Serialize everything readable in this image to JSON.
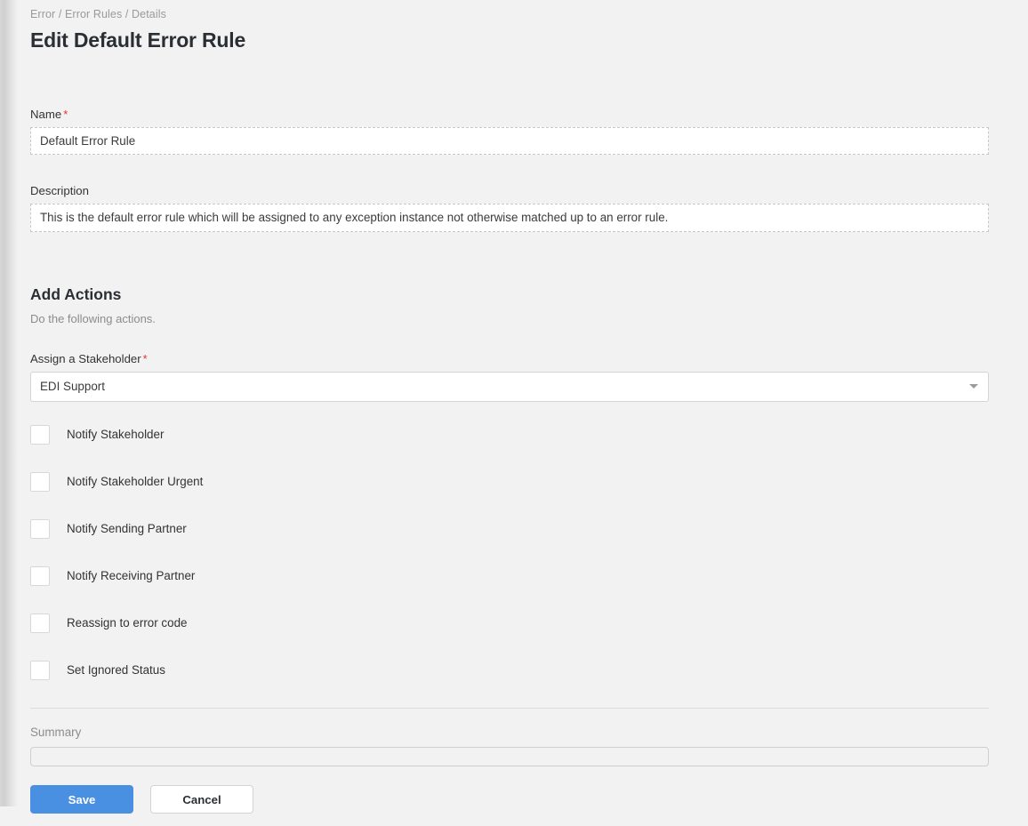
{
  "breadcrumb": {
    "text": "Error / Error Rules / Details"
  },
  "header": {
    "title": "Edit Default Error Rule"
  },
  "form": {
    "name": {
      "label": "Name",
      "required_marker": "*",
      "value": "Default Error Rule",
      "placeholder": ""
    },
    "description": {
      "label": "Description",
      "value": "This is the default error rule which will be assigned to any exception instance not otherwise matched up to an error rule.",
      "placeholder": ""
    }
  },
  "actions_section": {
    "title": "Add Actions",
    "subtitle": "Do the following actions.",
    "stakeholder": {
      "label": "Assign a Stakeholder",
      "required_marker": "*",
      "selected": "EDI Support",
      "arrow_icon": "chevron-down-icon"
    },
    "checkboxes": [
      {
        "label": "Notify Stakeholder",
        "checked": false
      },
      {
        "label": "Notify Stakeholder Urgent",
        "checked": false
      },
      {
        "label": "Notify Sending Partner",
        "checked": false
      },
      {
        "label": "Notify Receiving Partner",
        "checked": false
      },
      {
        "label": "Reassign to error code",
        "checked": false
      },
      {
        "label": "Set Ignored Status",
        "checked": false
      }
    ]
  },
  "summary": {
    "label": "Summary",
    "value": "",
    "placeholder": ""
  },
  "footer": {
    "save_label": "Save",
    "cancel_label": "Cancel"
  },
  "colors": {
    "page_background": "#f2f2f2",
    "primary_button": "#4a90e2",
    "required_star": "#e8312f",
    "muted_text": "#8c8c8c",
    "input_background": "#ffffff"
  }
}
